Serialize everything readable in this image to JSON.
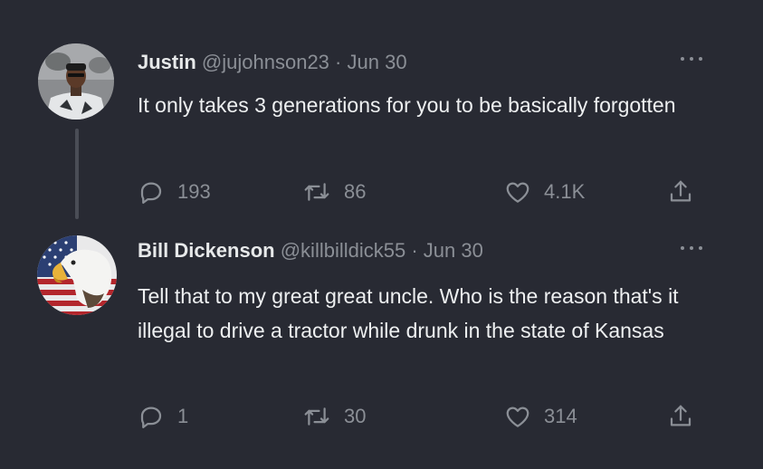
{
  "tweets": [
    {
      "name": "Justin",
      "handle": "@jujohnson23",
      "separator": "·",
      "date": "Jun 30",
      "text": "It only takes 3 generations for you to be basically forgotten",
      "replies": "193",
      "retweets": "86",
      "likes": "4.1K",
      "avatar_icon": "profile-photo"
    },
    {
      "name": "Bill Dickenson",
      "handle": "@killbilldick55",
      "separator": "·",
      "date": "Jun 30",
      "text": "Tell that to my great great uncle. Who is the reason that's it illegal to drive a tractor while drunk in the state of Kansas",
      "replies": "1",
      "retweets": "30",
      "likes": "314",
      "avatar_icon": "eagle-flag-avatar"
    }
  ],
  "icons": {
    "reply": "reply-icon",
    "retweet": "retweet-icon",
    "like": "heart-icon",
    "share": "share-icon",
    "more": "more-icon"
  },
  "colors": {
    "background": "#282a33",
    "text": "#e7e9ea",
    "muted": "#8b8f96",
    "thread_line": "#4a4d56"
  }
}
